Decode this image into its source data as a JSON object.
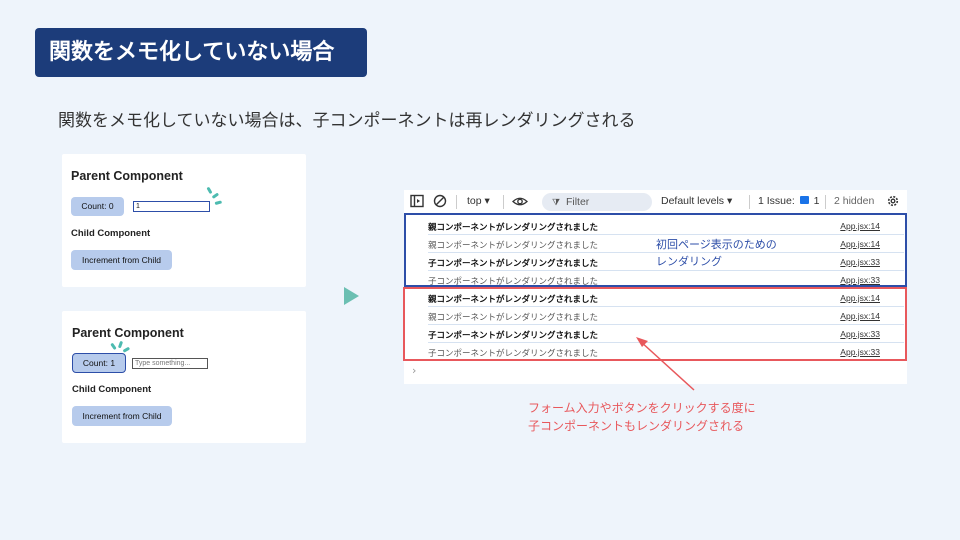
{
  "title": "関数をメモ化していない場合",
  "subtitle": "関数をメモ化していない場合は、子コンポーネントは再レンダリングされる",
  "card1": {
    "heading": "Parent Component",
    "count_button": "Count: 0",
    "input_value": "1",
    "child_heading": "Child Component",
    "child_button": "Increment from Child"
  },
  "card2": {
    "heading": "Parent Component",
    "count_button": "Count: 1",
    "input_placeholder": "Type something...",
    "child_heading": "Child Component",
    "child_button": "Increment from Child"
  },
  "devtools": {
    "toolbar": {
      "context": "top",
      "filter_placeholder": "Filter",
      "levels": "Default levels",
      "issues_label": "1 Issue:",
      "issues_count": "1",
      "hidden": "2 hidden"
    },
    "logs": [
      {
        "message": "親コンポーネントがレンダリングされました",
        "source": "App.jsx:14"
      },
      {
        "message": "親コンポーネントがレンダリングされました",
        "source": "App.jsx:14"
      },
      {
        "message": "子コンポーネントがレンダリングされました",
        "source": "App.jsx:33"
      },
      {
        "message": "子コンポーネントがレンダリングされました",
        "source": "App.jsx:33"
      },
      {
        "message": "親コンポーネントがレンダリングされました",
        "source": "App.jsx:14"
      },
      {
        "message": "親コンポーネントがレンダリングされました",
        "source": "App.jsx:14"
      },
      {
        "message": "子コンポーネントがレンダリングされました",
        "source": "App.jsx:33"
      },
      {
        "message": "子コンポーネントがレンダリングされました",
        "source": "App.jsx:33"
      }
    ],
    "prompt": "›"
  },
  "annotations": {
    "blue_line1": "初回ページ表示のための",
    "blue_line2": "レンダリング",
    "red_line1": "フォーム入力やボタンをクリックする度に",
    "red_line2": "子コンポーネントもレンダリングされる"
  },
  "colors": {
    "title_bg": "#1c3c7a",
    "blue": "#2d4ea8",
    "red": "#e8585c",
    "accent_teal": "#6bbfb2",
    "button_bg": "#b7cbec"
  },
  "icons": [
    "sidebar-toggle-icon",
    "clear-console-icon",
    "eye-icon",
    "filter-icon",
    "issue-icon",
    "settings-gear-icon",
    "play-arrow-icon"
  ]
}
